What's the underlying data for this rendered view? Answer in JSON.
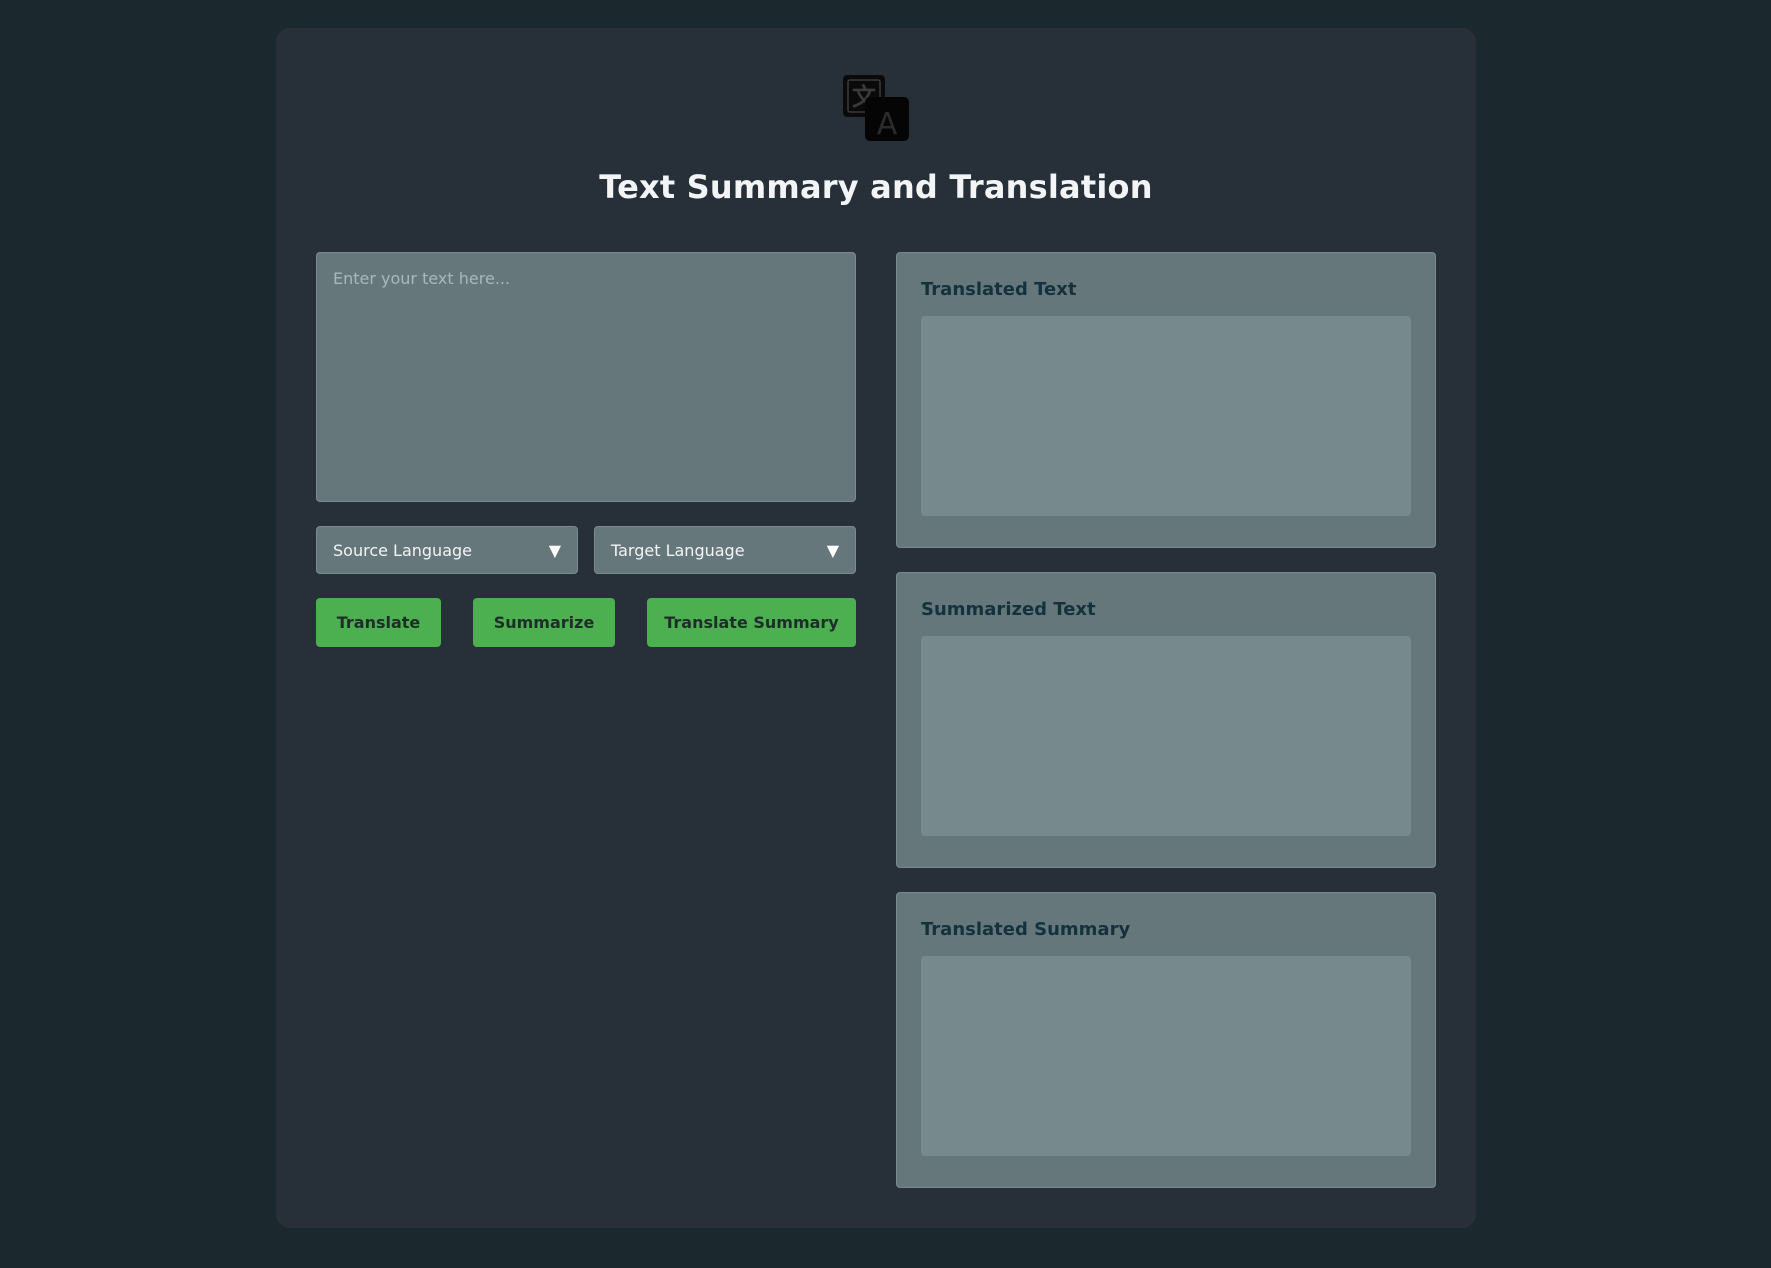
{
  "app": {
    "title": "Text Summary and Translation",
    "logo_icon": "translate-icon"
  },
  "input": {
    "placeholder": "Enter your text here...",
    "value": ""
  },
  "selects": {
    "source": {
      "label": "Source Language",
      "icon": "chevron-down-icon"
    },
    "target": {
      "label": "Target Language",
      "icon": "chevron-down-icon"
    },
    "chevron_glyph": "▼"
  },
  "buttons": {
    "translate": "Translate",
    "summarize": "Summarize",
    "translate_summary": "Translate Summary"
  },
  "panels": [
    {
      "label": "Translated Text",
      "value": ""
    },
    {
      "label": "Summarized Text",
      "value": ""
    },
    {
      "label": "Translated Summary",
      "value": ""
    }
  ],
  "colors": {
    "page_background": "#1b282e",
    "card_background": "#273038",
    "panel_background": "#66777b",
    "output_background": "#768a8d",
    "accent_button": "#4caf50",
    "label_text": "#13323d"
  }
}
